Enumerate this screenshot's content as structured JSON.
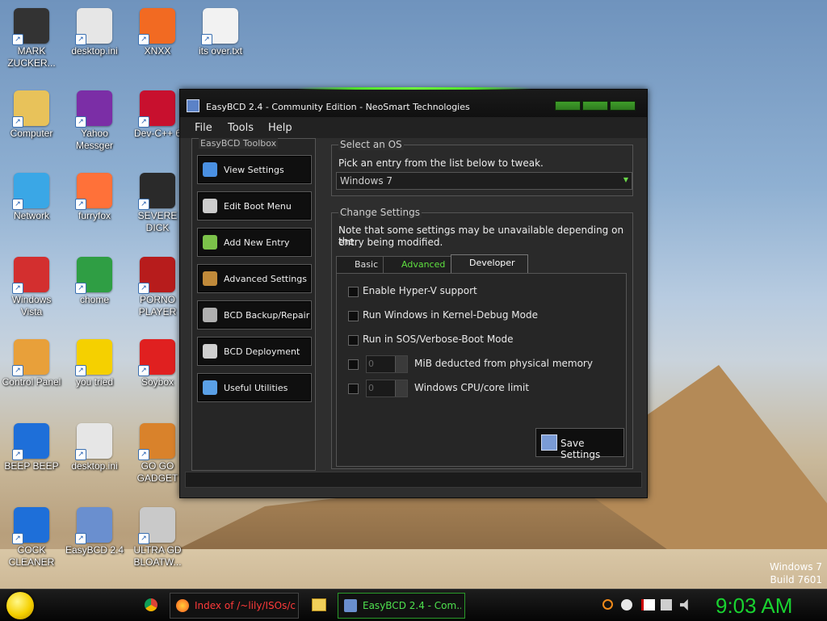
{
  "desktop": {
    "icons": [
      {
        "label": "MARK ZUCKER...",
        "icon": "person-icon",
        "color": "#333333"
      },
      {
        "label": "desktop.ini",
        "icon": "settings-file-icon",
        "color": "#e6e6e6"
      },
      {
        "label": "XNXX",
        "icon": "xampp-icon",
        "color": "#f26a22"
      },
      {
        "label": "its over.txt",
        "icon": "text-file-icon",
        "color": "#f2f2f2"
      },
      {
        "label": "Computer",
        "icon": "computer-icon",
        "color": "#e8c25a"
      },
      {
        "label": "Yahoo Messger",
        "icon": "yahoo-messenger-icon",
        "color": "#7b2ea6"
      },
      {
        "label": "Dev-C++ 6",
        "icon": "devcpp-icon",
        "color": "#c8102e"
      },
      {
        "label": "Network",
        "icon": "network-icon",
        "color": "#3aa7e6"
      },
      {
        "label": "furryfox",
        "icon": "firefox-icon",
        "color": "#ff7139"
      },
      {
        "label": "SEVERE DICK",
        "icon": "sd-card-icon",
        "color": "#2a2a2a"
      },
      {
        "label": "Windows Vista",
        "icon": "recycle-bin-icon",
        "color": "#d32f2f"
      },
      {
        "label": "chome",
        "icon": "chrome-icon",
        "color": "#2f9e44"
      },
      {
        "label": "PORNO PLAYER",
        "icon": "flash-player-icon",
        "color": "#b71c1c"
      },
      {
        "label": "Control Panel",
        "icon": "control-panel-icon",
        "color": "#e8a03a"
      },
      {
        "label": "you tried",
        "icon": "star-icon",
        "color": "#f5d000"
      },
      {
        "label": "Soybox",
        "icon": "soybox-icon",
        "color": "#e02020"
      },
      {
        "label": "BEEP BEEP",
        "icon": "blue-book-icon",
        "color": "#1e6fd9"
      },
      {
        "label": "desktop.ini",
        "icon": "settings-file-icon",
        "color": "#e6e6e6"
      },
      {
        "label": "GO GO GADGET",
        "icon": "briefcase-icon",
        "color": "#d9822b"
      },
      {
        "label": "COCK CLEANER",
        "icon": "blue-book-icon",
        "color": "#1e6fd9"
      },
      {
        "label": "EasyBCD 2.4",
        "icon": "easybcd-icon",
        "color": "#6a8fcf"
      },
      {
        "label": "ULTRA GD BLOATW...",
        "icon": "disc-icon",
        "color": "#c9c9c9"
      }
    ],
    "watermark": {
      "line1": "Windows 7",
      "line2": "Build 7601"
    }
  },
  "window": {
    "title": "EasyBCD 2.4 - Community Edition - NeoSmart Technologies",
    "menu": [
      "File",
      "Tools",
      "Help"
    ],
    "toolbox": {
      "caption": "EasyBCD Toolbox",
      "buttons": [
        {
          "label": "View Settings",
          "icon": "monitor-icon",
          "color": "#4a90e2"
        },
        {
          "label": "Edit Boot Menu",
          "icon": "tools-icon",
          "color": "#cccccc"
        },
        {
          "label": "Add New Entry",
          "icon": "add-gear-icon",
          "color": "#7cc24a"
        },
        {
          "label": "Advanced Settings",
          "icon": "chip-icon",
          "color": "#c08a3a"
        },
        {
          "label": "BCD Backup/Repair",
          "icon": "database-icon",
          "color": "#b0b0b0"
        },
        {
          "label": "BCD Deployment",
          "icon": "deploy-icon",
          "color": "#d0d0d0"
        },
        {
          "label": "Useful Utilities",
          "icon": "window-icon",
          "color": "#5aa0e6"
        }
      ]
    },
    "select_os": {
      "caption": "Select an OS",
      "hint": "Pick an entry from the list below to tweak.",
      "selected": "Windows 7"
    },
    "change_settings": {
      "caption": "Change Settings",
      "note_line1": "Note that some settings may be unavailable depending on the",
      "note_line2": "entry being modified.",
      "tabs": [
        "Basic",
        "Advanced",
        "Developer"
      ],
      "options": [
        "Enable Hyper-V support",
        "Run Windows in Kernel-Debug Mode",
        "Run in SOS/Verbose-Boot Mode"
      ],
      "spin_options": [
        {
          "value": "0",
          "label": "MiB deducted from physical memory"
        },
        {
          "value": "0",
          "label": "Windows CPU/core limit"
        }
      ],
      "save_label": "Save Settings"
    }
  },
  "taskbar": {
    "items": [
      {
        "label": "Index of /~lily/ISOs/cr...",
        "icon": "firefox-icon"
      },
      {
        "label": "EasyBCD 2.4 - Com...",
        "icon": "easybcd-icon"
      }
    ],
    "clock": "9:03 AM",
    "colors": {
      "clock": "#19d230",
      "window_accent": "#4fe02a"
    }
  }
}
